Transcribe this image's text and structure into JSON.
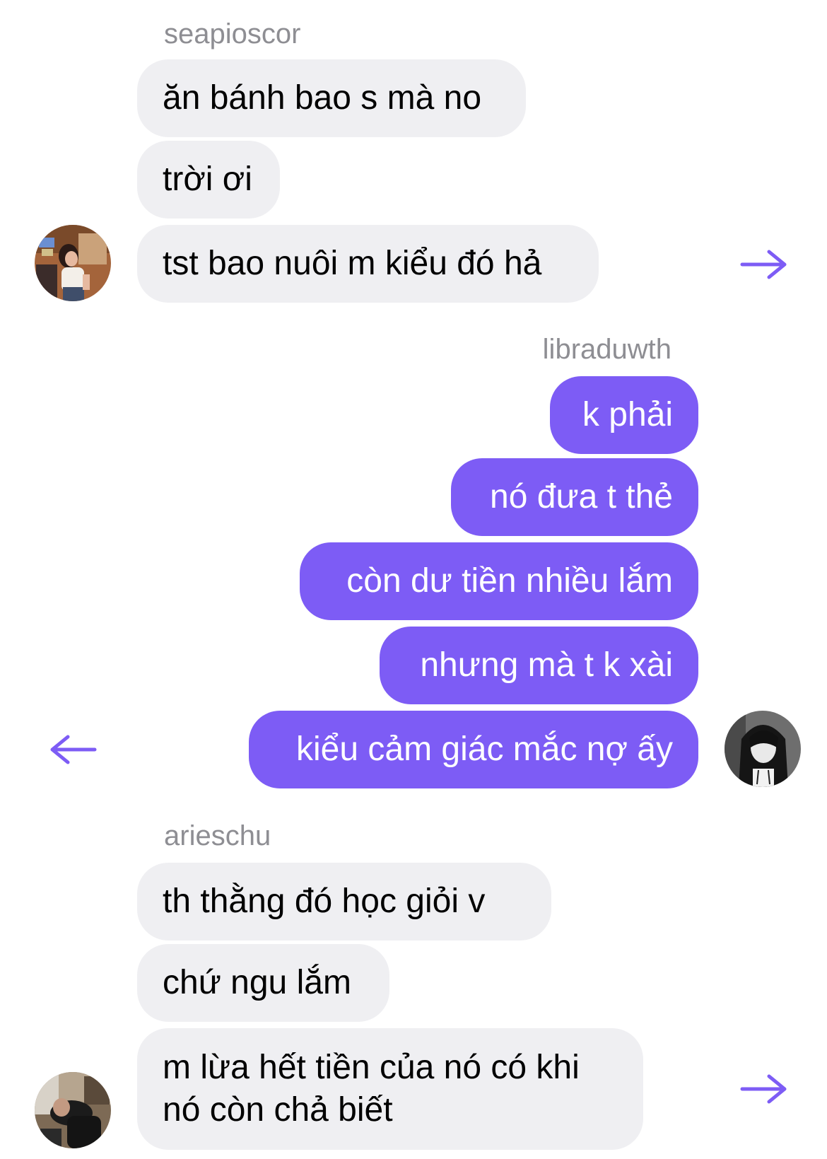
{
  "theme": {
    "accent": "#7d5cf5",
    "incoming_bg": "#efeff2",
    "name_color": "#8e8e93"
  },
  "groups": [
    {
      "sender": "seapioscor",
      "direction": "incoming",
      "messages": [
        "ăn bánh bao s mà no",
        "trời ơi",
        "tst bao nuôi m kiểu đó hả"
      ],
      "avatar": "avatar-photo-girl",
      "arrow": "arrow-right-icon"
    },
    {
      "sender": "libraduwth",
      "direction": "outgoing",
      "messages": [
        "k phải",
        "nó đưa t thẻ",
        "còn dư tiền nhiều lắm",
        "nhưng mà t k xài",
        "kiểu cảm giác mắc nợ ấy"
      ],
      "avatar": "avatar-photo-hood",
      "arrow": "arrow-left-icon"
    },
    {
      "sender": "arieschu",
      "direction": "incoming",
      "messages": [
        "th thằng đó học giỏi v",
        "chứ ngu lắm",
        "m lừa hết tiền của nó có khi nó còn chả biết"
      ],
      "avatar": "avatar-photo-guy",
      "arrow": "arrow-right-icon"
    }
  ]
}
